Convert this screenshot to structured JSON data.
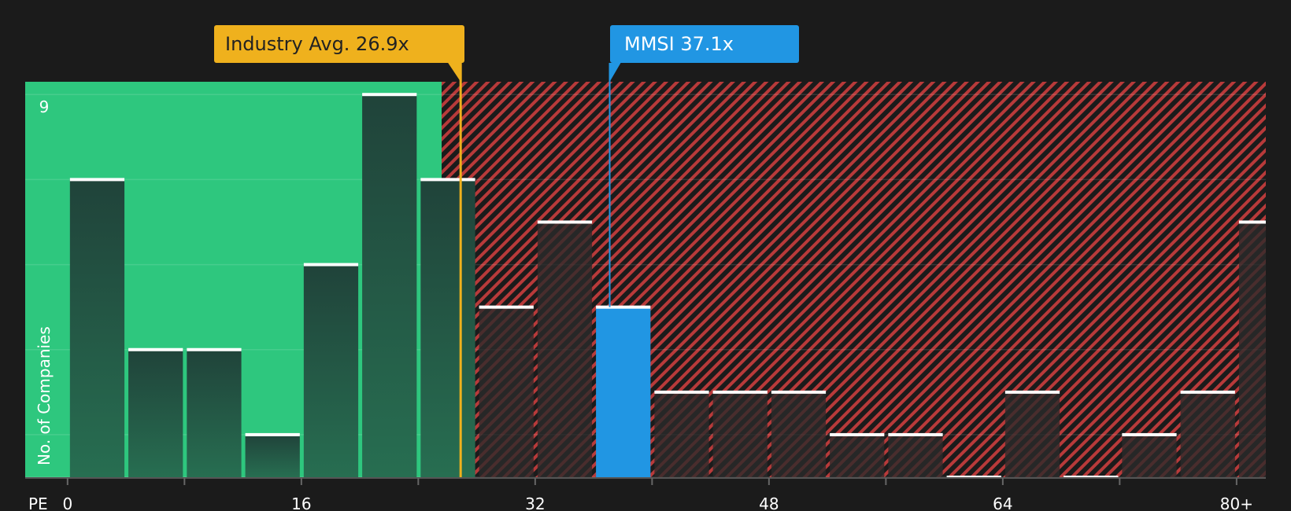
{
  "chart_data": {
    "type": "bar",
    "xlabel": "PE",
    "ylabel": "No. of Companies",
    "x_ticks": [
      "0",
      "16",
      "32",
      "48",
      "64",
      "80+"
    ],
    "x_tick_values": [
      0,
      16,
      32,
      48,
      64,
      80
    ],
    "y_ticks": [
      "9"
    ],
    "y_tick_values": [
      9
    ],
    "ylim": [
      0,
      9.3
    ],
    "xlim": [
      -2.9,
      82
    ],
    "bin_width": 4,
    "bins": [
      {
        "x": 2,
        "value": 7
      },
      {
        "x": 6,
        "value": 3
      },
      {
        "x": 10,
        "value": 3
      },
      {
        "x": 14,
        "value": 1
      },
      {
        "x": 18,
        "value": 5
      },
      {
        "x": 22,
        "value": 9
      },
      {
        "x": 26,
        "value": 7
      },
      {
        "x": 30,
        "value": 4
      },
      {
        "x": 34,
        "value": 6
      },
      {
        "x": 38,
        "value": 4,
        "highlight": true
      },
      {
        "x": 42,
        "value": 2
      },
      {
        "x": 46,
        "value": 2
      },
      {
        "x": 50,
        "value": 2
      },
      {
        "x": 54,
        "value": 1
      },
      {
        "x": 58,
        "value": 1
      },
      {
        "x": 62,
        "value": 0
      },
      {
        "x": 66,
        "value": 2
      },
      {
        "x": 70,
        "value": 0
      },
      {
        "x": 74,
        "value": 1
      },
      {
        "x": 78,
        "value": 2
      },
      {
        "x": 82,
        "value": 6
      }
    ],
    "industry_avg": {
      "label": "Industry Avg. 26.9x",
      "value": 26.9
    },
    "company": {
      "label": "MMSI 37.1x",
      "value": 37.1
    },
    "fair_zone_end": 25.6,
    "colors": {
      "background": "#1b1b1b",
      "good_zone": "#2ec77e",
      "bad_zone": "#b83a3a",
      "bar": "#22473a",
      "highlight_bar": "#2196e3",
      "industry": "#efb11d",
      "company": "#2196e3"
    }
  }
}
